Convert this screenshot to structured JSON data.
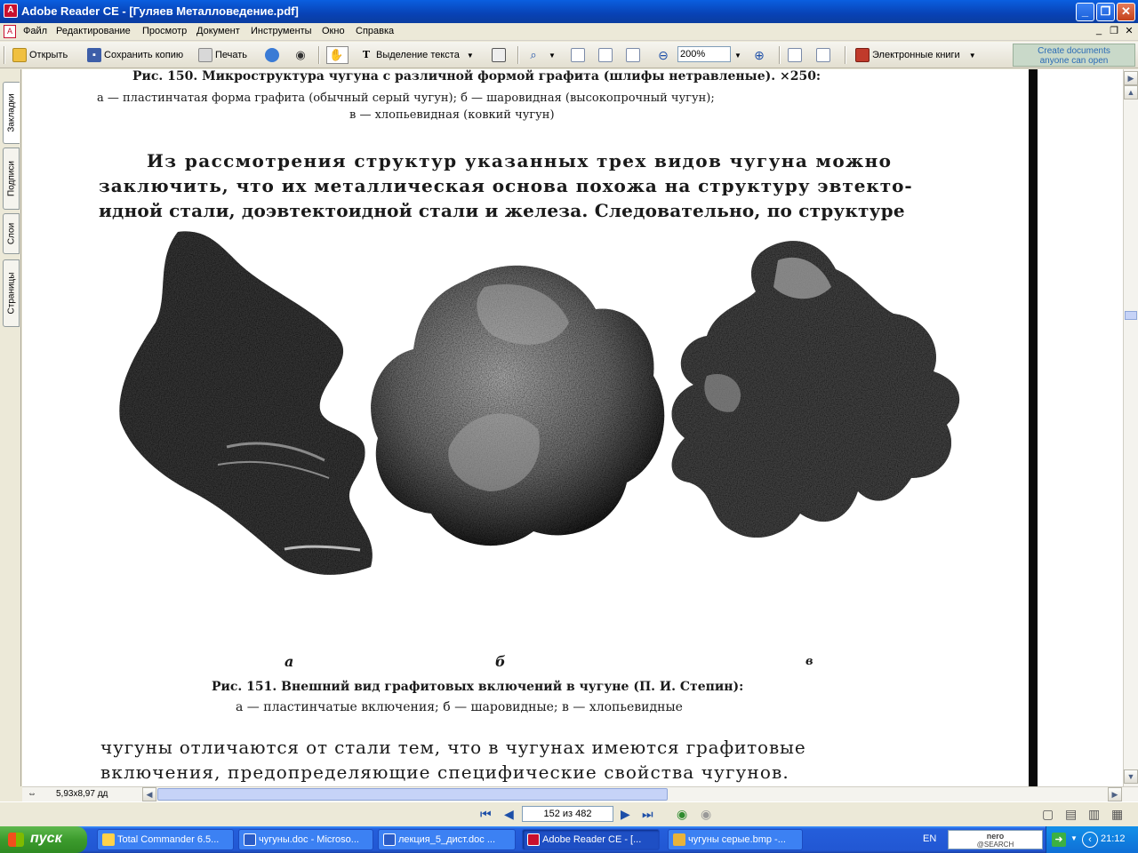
{
  "window": {
    "title": "Adobe Reader CE - [Гуляев Металловедение.pdf]",
    "app_icon": "adobe-reader-icon"
  },
  "menu": {
    "items": [
      "Файл",
      "Редактирование",
      "Просмотр",
      "Документ",
      "Инструменты",
      "Окно",
      "Справка"
    ]
  },
  "toolbar": {
    "open_label": "Открыть",
    "save_copy_label": "Сохранить копию",
    "print_label": "Печать",
    "select_text_label": "Выделение текста",
    "zoom_value": "200%",
    "ebooks_label": "Электронные книги",
    "promo_line1": "Create documents",
    "promo_line2": "anyone can open"
  },
  "nav_tabs": [
    "Закладки",
    "Подписи",
    "Слои",
    "Страницы"
  ],
  "document": {
    "fig150_caption": "Рис. 150. Микроструктура чугуна с различной формой графита (шлифы нетравленые). ×250:",
    "fig150_line2": "а — пластинчатая форма графита (обычный серый чугун); б — шаровидная (высокопрочный чугун);",
    "fig150_line3": "в — хлопьевидная (ковкий чугун)",
    "para1_line1": "Из рассмотрения структур указанных трех видов чугуна можно",
    "para1_line2": "заключить, что их металлическая основа похожа на структуру эвтекто-",
    "para1_line3": "идной стали, доэвтектоидной стали и железа. Следовательно, по структуре",
    "label_a": "а",
    "label_b": "б",
    "label_v": "в",
    "fig151_caption": "Рис. 151. Внешний вид графитовых включений в чугуне (П. И. Степин):",
    "fig151_line2": "а — пластинчатые включения; б — шаровидные; в — хлопьевидные",
    "para2_line1": "чугуны отличаются от стали тем, что в чугунах имеются графитовые",
    "para2_line2": "включения, предопределяющие специфические свойства чугунов."
  },
  "status": {
    "page_size": "5,93x8,97 дд",
    "page_indicator": "152 из 482"
  },
  "taskbar": {
    "start_label": "пуск",
    "tasks": [
      "Total Commander 6.5...",
      "чугуны.doc - Microso...",
      "лекция_5_дист.doc ...",
      "Adobe Reader CE - [...",
      "чугуны серые.bmp -..."
    ],
    "lang": "EN",
    "nero_line1": "nero",
    "nero_line2": "@SEARCH",
    "clock": "21:12"
  },
  "colors": {
    "titlebar": "#0842b5",
    "taskbar": "#245edb",
    "start": "#3c9b2d"
  }
}
